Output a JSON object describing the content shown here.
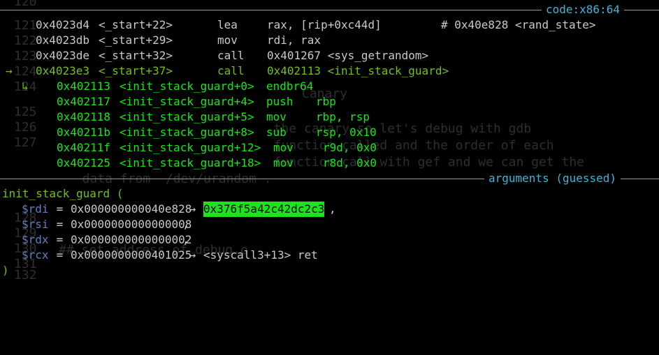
{
  "background": {
    "line_numbers": [
      "120",
      "121",
      "122",
      "123",
      "124",
      "124",
      "125",
      "126",
      "127",
      "128",
      "129",
      "130",
      "131",
      "132"
    ],
    "ghost_lines": [
      "Canary",
      "  the canary so let's debug with gdb",
      "  function called and the order of each",
      "  function call with gef and we can get the",
      "  data from  /dev/urandom .",
      "## set address of debug.o"
    ]
  },
  "code_section": {
    "title": "code:x86:64",
    "prev_lines": [
      {
        "addr": "0x4023d4",
        "sym": "<_start+22>",
        "mnem": "lea",
        "ops": "rax, [rip+0xc44d]",
        "comment": "# 0x40e828 <rand_state>"
      },
      {
        "addr": "0x4023db",
        "sym": "<_start+29>",
        "mnem": "mov",
        "ops": "rdi, rax",
        "comment": ""
      },
      {
        "addr": "0x4023de",
        "sym": "<_start+32>",
        "mnem": "call",
        "ops": "0x401267 <sys_getrandom>",
        "comment": ""
      }
    ],
    "current_line": {
      "marker": "→",
      "addr": "0x4023e3",
      "sym": "<_start+37>",
      "mnem": "call",
      "ops": "0x402113 <init_stack_guard>"
    },
    "branch_marker": "↳",
    "target_lines": [
      {
        "addr": "0x402113",
        "sym": "<init_stack_guard+0>",
        "mnem": "endbr64",
        "ops": ""
      },
      {
        "addr": "0x402117",
        "sym": "<init_stack_guard+4>",
        "mnem": "push",
        "ops": "rbp"
      },
      {
        "addr": "0x402118",
        "sym": "<init_stack_guard+5>",
        "mnem": "mov",
        "ops": "rbp, rsp"
      },
      {
        "addr": "0x40211b",
        "sym": "<init_stack_guard+8>",
        "mnem": "sub",
        "ops": "rsp, 0x10"
      },
      {
        "addr": "0x40211f",
        "sym": "<init_stack_guard+12>",
        "mnem": "mov",
        "ops": "r9d, 0x0"
      },
      {
        "addr": "0x402125",
        "sym": "<init_stack_guard+18>",
        "mnem": "mov",
        "ops": "r8d, 0x0"
      }
    ]
  },
  "args_section": {
    "title": "arguments (guessed)",
    "func_open": "init_stack_guard (",
    "args": [
      {
        "reg": "$rdi",
        "eq": " = ",
        "val": "0x000000000040e828",
        "arrow": " → ",
        "deref": "0x376f5a42c42dc2c3",
        "deref_highlight": true,
        "tail": ","
      },
      {
        "reg": "$rsi",
        "eq": " = ",
        "val": "0x0000000000000008",
        "arrow": "",
        "deref": "",
        "deref_highlight": false,
        "tail": ","
      },
      {
        "reg": "$rdx",
        "eq": " = ",
        "val": "0x0000000000000002",
        "arrow": "",
        "deref": "",
        "deref_highlight": false,
        "tail": ","
      },
      {
        "reg": "$rcx",
        "eq": " = ",
        "val": "0x0000000000401025",
        "arrow": " → ",
        "deref": "<syscall3+13> ret",
        "deref_highlight": false,
        "tail": ""
      }
    ],
    "func_close": ")"
  },
  "colors": {
    "title": "#42b4d6",
    "rule": "#9a9a9a",
    "past_code": "#c9c9c9",
    "current_code": "#6fc01c",
    "target_code": "#19e619",
    "register": "#5f7fbf",
    "highlight_bg": "#19e619"
  }
}
